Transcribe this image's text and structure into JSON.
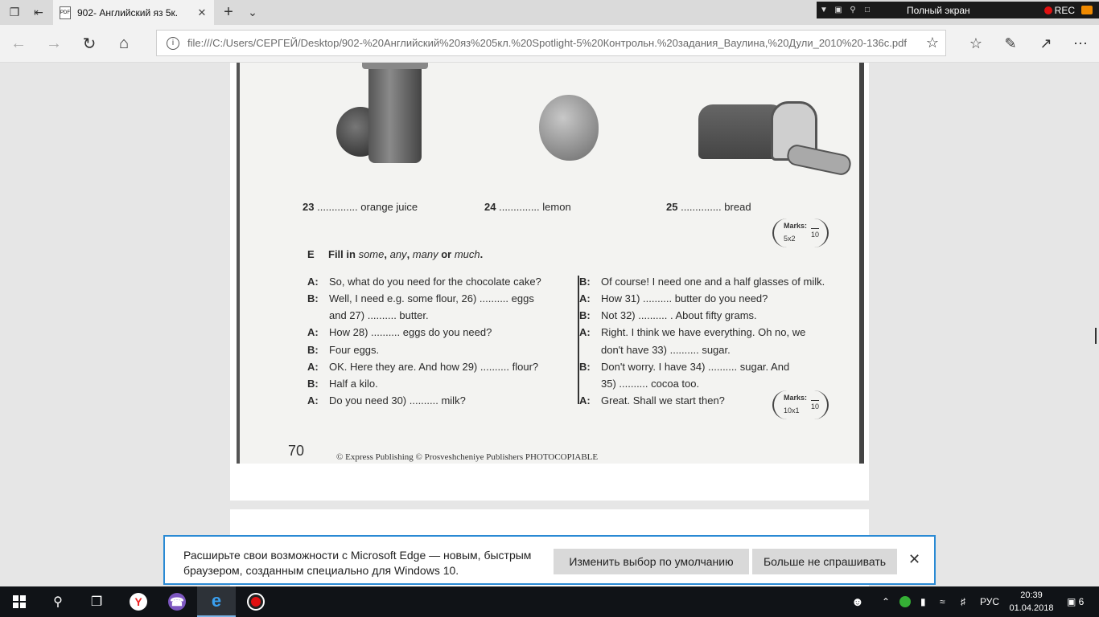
{
  "browser": {
    "tab_title": "902- Английский яз 5к.",
    "tab_pdf_label": "PDF",
    "url": "file:///C:/Users/СЕРГЕЙ/Desktop/902-%20Английский%20яз%205кл.%20Spotlight-5%20Контрольн.%20задания_Ваулина,%20Дули_2010%20-136с.pdf"
  },
  "recorder": {
    "fullscreen_label": "Полный экран",
    "rec_label": "REC"
  },
  "worksheet": {
    "items_food": [
      {
        "num": "23",
        "blank": "..............",
        "word": "orange juice"
      },
      {
        "num": "24",
        "blank": "..............",
        "word": "lemon"
      },
      {
        "num": "25",
        "blank": "..............",
        "word": "bread"
      }
    ],
    "marks_1": {
      "label": "Marks:",
      "scheme": "5x2",
      "total": "10"
    },
    "section_letter": "E",
    "section_title_pre": "Fill in ",
    "section_some": "some",
    "section_comma1": ", ",
    "section_any": "any",
    "section_comma2": ", ",
    "section_many": "many",
    "section_or": " or ",
    "section_much": "much",
    "section_dot": ".",
    "left_dialogue": [
      {
        "speaker": "A:",
        "text": "So, what do you need for the chocolate cake?"
      },
      {
        "speaker": "B:",
        "text": "Well, I need e.g. some flour, 26) .......... eggs"
      },
      {
        "speaker": "",
        "text": "and 27) .......... butter."
      },
      {
        "speaker": "A:",
        "text": "How 28) .......... eggs do you need?"
      },
      {
        "speaker": "B:",
        "text": "Four eggs."
      },
      {
        "speaker": "A:",
        "text": "OK. Here they are. And how 29) .......... flour?"
      },
      {
        "speaker": "B:",
        "text": "Half a kilo."
      },
      {
        "speaker": "A:",
        "text": "Do you need 30) .......... milk?"
      }
    ],
    "right_dialogue": [
      {
        "speaker": "B:",
        "text": "Of course! I need one and a half glasses of milk."
      },
      {
        "speaker": "A:",
        "text": "How 31) .......... butter do you need?"
      },
      {
        "speaker": "B:",
        "text": "Not 32) .......... . About fifty grams."
      },
      {
        "speaker": "A:",
        "text": "Right. I think we have everything. Oh no, we"
      },
      {
        "speaker": "",
        "text": "don't have 33) .......... sugar."
      },
      {
        "speaker": "B:",
        "text": "Don't worry. I have 34) .......... sugar. And"
      },
      {
        "speaker": "",
        "text": "35) .......... cocoa too."
      },
      {
        "speaker": "A:",
        "text": "Great. Shall we start then?"
      }
    ],
    "marks_2": {
      "label": "Marks:",
      "scheme": "10x1",
      "total": "10"
    },
    "page_number": "70",
    "copyright": "© Express Publishing © Prosveshcheniye Publishers  PHOTOCOPIABLE"
  },
  "notification": {
    "message": "Расширьте свои возможности с Microsoft Edge — новым, быстрым браузером, созданным специально для Windows 10.",
    "change_default_label": "Изменить выбор по умолчанию",
    "dont_ask_label": "Больше не спрашивать"
  },
  "taskbar": {
    "lang": "РУС",
    "time": "20:39",
    "date": "01.04.2018",
    "notifications_count": "6"
  }
}
